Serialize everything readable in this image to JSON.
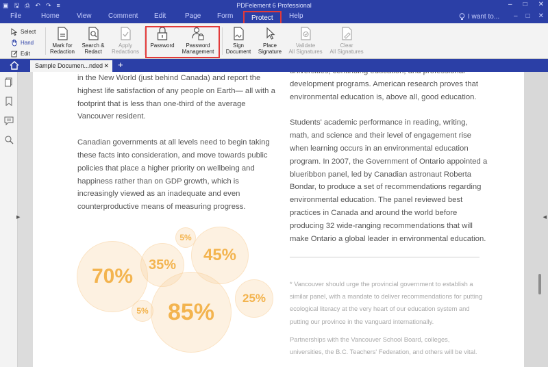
{
  "window": {
    "title": "PDFelement 6 Professional"
  },
  "menu": {
    "tabs": [
      "File",
      "Home",
      "View",
      "Comment",
      "Edit",
      "Page",
      "Form",
      "Protect",
      "Help"
    ],
    "active": "Protect",
    "search_placeholder": "I want to..."
  },
  "ribbon": {
    "select_label": "Select",
    "hand_label": "Hand",
    "edit_label": "Edit",
    "tools": [
      {
        "l1": "Mark for",
        "l2": "Redaction"
      },
      {
        "l1": "Search &",
        "l2": "Redact"
      },
      {
        "l1": "Apply",
        "l2": "Redactions"
      },
      {
        "l1": "Password",
        "l2": ""
      },
      {
        "l1": "Password",
        "l2": "Management"
      },
      {
        "l1": "Sign",
        "l2": "Document"
      },
      {
        "l1": "Place",
        "l2": "Signature"
      },
      {
        "l1": "Validate",
        "l2": "All Signatures"
      },
      {
        "l1": "Clear",
        "l2": "All Signatures"
      }
    ]
  },
  "tabs": {
    "document": "Sample Documen...nded"
  },
  "document": {
    "left_paragraphs": [
      "in the New World (just behind Canada) and report the highest life satisfaction of any people on Earth— all with a footprint that is less than one-third of the average Vancouver resident.",
      "Canadian governments at all levels need to begin taking these facts into consideration, and move towards public policies that place a higher priority on wellbeing and happiness rather than on GDP growth, which is increasingly viewed as an inadequate and even counterproductive means of measuring progress."
    ],
    "right_paragraphs": [
      "universities, continuing education, and professional development programs. American research proves that environmental education is, above all, good education.",
      "Students' academic performance in reading, writing, math, and science and their level of engagement rise when learning occurs in an environmental education program. In 2007, the Government of Ontario appointed a blueribbon panel, led by Canadian astronaut Roberta Bondar, to produce a set of recommendations regarding environmental education. The panel reviewed best practices in Canada and around the world before producing 32 wide-ranging recommendations that will make Ontario a global leader in environmental education."
    ],
    "notes": [
      "* Vancouver should urge the provincial government to establish a similar panel, with a mandate to deliver recommendations for putting ecological literacy at the very heart of our education system and putting our province in the vanguard internationally.",
      "Partnerships with the Vancouver School Board, colleges, universities, the B.C. Teachers' Federation, and others will be vital."
    ],
    "bubbles": [
      "70%",
      "35%",
      "5%",
      "45%",
      "85%",
      "5%",
      "25%"
    ]
  },
  "colors": {
    "brand": "#2b3fa6",
    "highlight": "#e23a3a",
    "bubble_text": "#f3b44f"
  }
}
